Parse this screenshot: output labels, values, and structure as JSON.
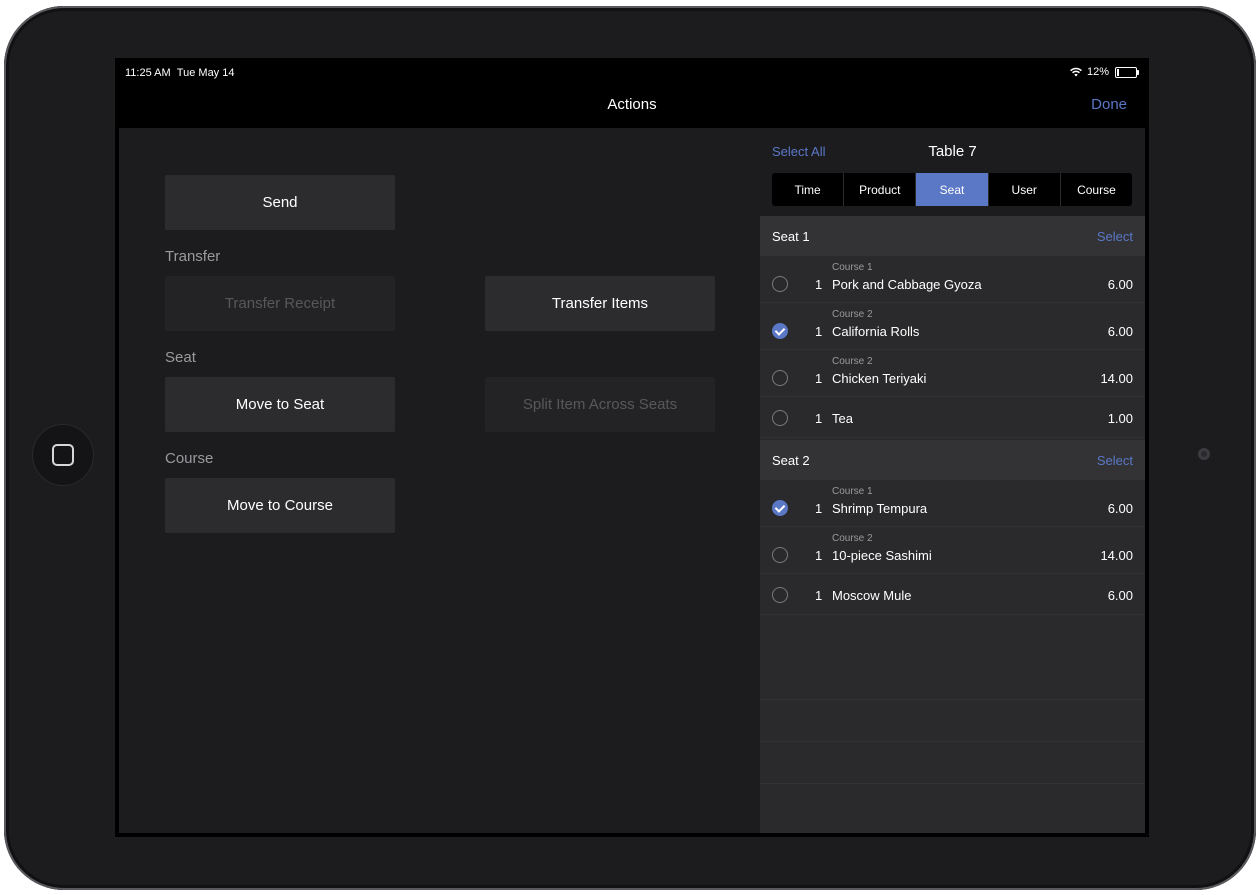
{
  "status": {
    "time": "11:25 AM",
    "date": "Tue May 14",
    "battery": "12%"
  },
  "nav": {
    "title": "Actions",
    "done": "Done"
  },
  "actions": {
    "send": "Send",
    "transfer_label": "Transfer",
    "transfer_receipt": "Transfer Receipt",
    "transfer_items": "Transfer Items",
    "seat_label": "Seat",
    "move_to_seat": "Move to Seat",
    "split_item": "Split Item Across Seats",
    "course_label": "Course",
    "move_to_course": "Move to Course"
  },
  "order": {
    "select_all": "Select All",
    "table": "Table 7",
    "sort_tabs": [
      "Time",
      "Product",
      "Seat",
      "User",
      "Course"
    ],
    "active_tab": "Seat",
    "seats": [
      {
        "name": "Seat 1",
        "select": "Select",
        "items": [
          {
            "course": "Course 1",
            "qty": "1",
            "name": "Pork and Cabbage Gyoza",
            "price": "6.00",
            "checked": false
          },
          {
            "course": "Course 2",
            "qty": "1",
            "name": "California Rolls",
            "price": "6.00",
            "checked": true
          },
          {
            "course": "Course 2",
            "qty": "1",
            "name": "Chicken Teriyaki",
            "price": "14.00",
            "checked": false
          },
          {
            "course": "",
            "qty": "1",
            "name": "Tea",
            "price": "1.00",
            "checked": false
          }
        ]
      },
      {
        "name": "Seat 2",
        "select": "Select",
        "items": [
          {
            "course": "Course 1",
            "qty": "1",
            "name": "Shrimp Tempura",
            "price": "6.00",
            "checked": true
          },
          {
            "course": "Course 2",
            "qty": "1",
            "name": "10-piece Sashimi",
            "price": "14.00",
            "checked": false
          },
          {
            "course": "",
            "qty": "1",
            "name": "Moscow Mule",
            "price": "6.00",
            "checked": false
          }
        ]
      }
    ]
  },
  "colors": {
    "accent": "#5b78c7",
    "panel": "#1c1c1e",
    "button": "#2c2c2e"
  },
  "icons": {
    "status": [
      "wifi-icon",
      "battery-icon"
    ],
    "device": [
      "home-button-icon",
      "camera-icon"
    ]
  }
}
